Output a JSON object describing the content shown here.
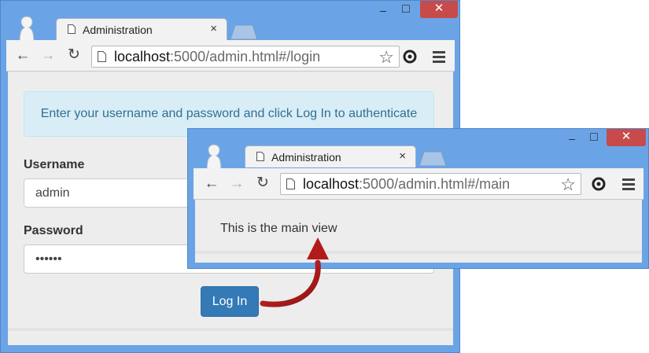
{
  "browser_login": {
    "tab": {
      "title": "Administration",
      "close_label": "×"
    },
    "window": {
      "minimize": "–",
      "maximize": "□",
      "close": "✕"
    },
    "address": {
      "host": "localhost",
      "rest": ":5000/admin.html#/login"
    },
    "page": {
      "alert": "Enter your username and password and click Log In to authenticate",
      "username_label": "Username",
      "username_value": "admin",
      "password_label": "Password",
      "password_value": "••••••",
      "login_button": "Log In"
    }
  },
  "browser_main": {
    "tab": {
      "title": "Administration",
      "close_label": "×"
    },
    "window": {
      "minimize": "–",
      "maximize": "□",
      "close": "✕"
    },
    "address": {
      "host": "localhost",
      "rest": ":5000/admin.html#/main"
    },
    "page": {
      "text": "This is the main view"
    }
  },
  "toolbar_icons": [
    "back-icon",
    "forward-icon",
    "reload-icon",
    "page-icon",
    "star-icon",
    "extension-icon",
    "menu-icon"
  ],
  "colors": {
    "frame": "#6ba4e6",
    "close": "#c74b4b",
    "alert_bg": "#d9edf7",
    "alert_text": "#31708f",
    "primary": "#337ab7",
    "arrow": "#b31b1b"
  }
}
